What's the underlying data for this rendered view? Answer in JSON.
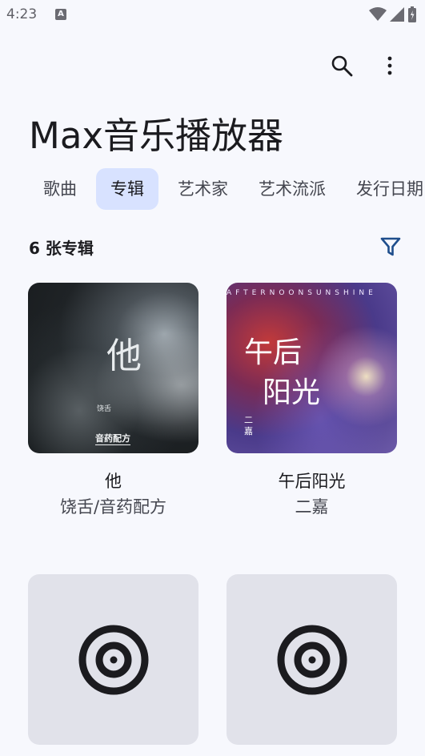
{
  "status_bar": {
    "time": "4:23",
    "notification_glyph": "A"
  },
  "app": {
    "title": "Max音乐播放器"
  },
  "tabs": [
    {
      "label": "歌曲",
      "active": false
    },
    {
      "label": "专辑",
      "active": true
    },
    {
      "label": "艺术家",
      "active": false
    },
    {
      "label": "艺术流派",
      "active": false
    },
    {
      "label": "发行日期",
      "active": false
    }
  ],
  "albums_header": {
    "count_label": "6 张专辑"
  },
  "albums": [
    {
      "name": "他",
      "artist": "饶舌/音药配方",
      "cover": {
        "big_text": "他",
        "small_text": "饶舌",
        "brand_text": "音药配方"
      }
    },
    {
      "name": "午后阳光",
      "artist": "二嘉",
      "cover": {
        "band_text": "AFTERNOONSUNSHINE",
        "line1": "午后",
        "line2": "阳光",
        "artist_text": "二\n嘉"
      }
    },
    {
      "name": "",
      "artist": "",
      "cover": {
        "icon": "album-placeholder-icon"
      }
    },
    {
      "name": "",
      "artist": "",
      "cover": {
        "icon": "album-placeholder-icon"
      }
    }
  ],
  "colors": {
    "background": "#f7f8fd",
    "active_tab": "#d8e2ff",
    "accent": "#1f4e8c",
    "placeholder": "#e1e2ea"
  },
  "icons": {
    "search": "search-icon",
    "more": "more-vert-icon",
    "filter": "filter-icon"
  }
}
